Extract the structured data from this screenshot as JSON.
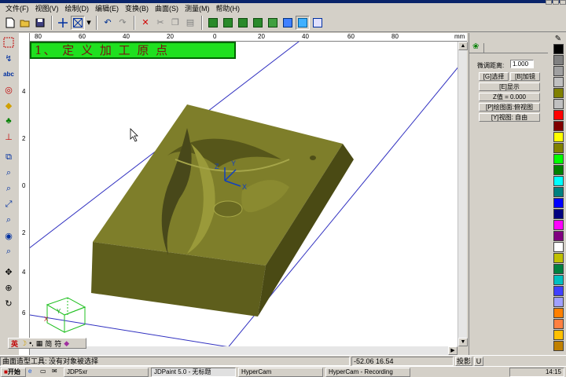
{
  "window": {
    "title": ""
  },
  "menu": {
    "items": [
      "文件(F)",
      "视图(V)",
      "绘制(D)",
      "编辑(E)",
      "变换(B)",
      "曲面(S)",
      "测量(M)",
      "帮助(H)"
    ]
  },
  "toolbar": {
    "buttons": [
      "new-icon",
      "open-icon",
      "save-icon",
      "crosshair-icon",
      "select-box-icon",
      "undo-icon",
      "redo-icon",
      "delete-icon",
      "cut-icon",
      "copy-icon",
      "paste-icon",
      "front-view-icon",
      "top-view-icon",
      "side-view-icon",
      "iso-view-icon",
      "box-view-icon",
      "render-icon",
      "shade-icon",
      "wire-icon"
    ]
  },
  "ruler": {
    "h_labels": [
      "80",
      "60",
      "40",
      "20",
      "0",
      "20",
      "40",
      "60",
      "80",
      "mm"
    ],
    "v_labels": [
      "4",
      "2",
      "0",
      "2",
      "4",
      "6"
    ]
  },
  "banner": {
    "text": "1、 定 义 加 工 原 点"
  },
  "axes": {
    "z": "Z",
    "y": "Y",
    "x": "X",
    "corner_y": "Y",
    "corner_x": "X"
  },
  "ime": {
    "lang": "英",
    "mode": "简",
    "chars": "符"
  },
  "panel": {
    "tab_icon": "gear-icon",
    "tab_label": "",
    "fine_tune_label": "微调距离:",
    "fine_tune_value": "1.000",
    "btn_select": "[G]选择",
    "btn_add": "[B]加镜",
    "btn_show": "[E]显示",
    "btn_z": "Z值 = 0.000",
    "btn_plane": "[P]绘图面:俯视图",
    "btn_view": "[Y]视图: 自由"
  },
  "palette": [
    "#000000",
    "#808080",
    "#a0a0a0",
    "#c0c0c0",
    "#808000",
    "#c0c0c0",
    "#ff0000",
    "#800000",
    "#ffff00",
    "#808000",
    "#00ff00",
    "#008000",
    "#00ffff",
    "#008080",
    "#0000ff",
    "#000080",
    "#ff00ff",
    "#800080",
    "#ffffff",
    "#c0c000",
    "#008040",
    "#00c0c0",
    "#4040ff",
    "#a0a0ff",
    "#ff8000",
    "#ff8040",
    "#ffc000",
    "#c08000"
  ],
  "status": {
    "message": "曲面造型工具: 没有对象被选择",
    "coords": "-52.06  16.54",
    "view_btn": "投影",
    "u_btn": "U"
  },
  "taskbar": {
    "start": "开始",
    "tasks": [
      "JDP5xr",
      "JDPaint 5.0 - 无标题",
      "HyperCam",
      "HyperCam - Recording"
    ],
    "clock": "14:15"
  }
}
